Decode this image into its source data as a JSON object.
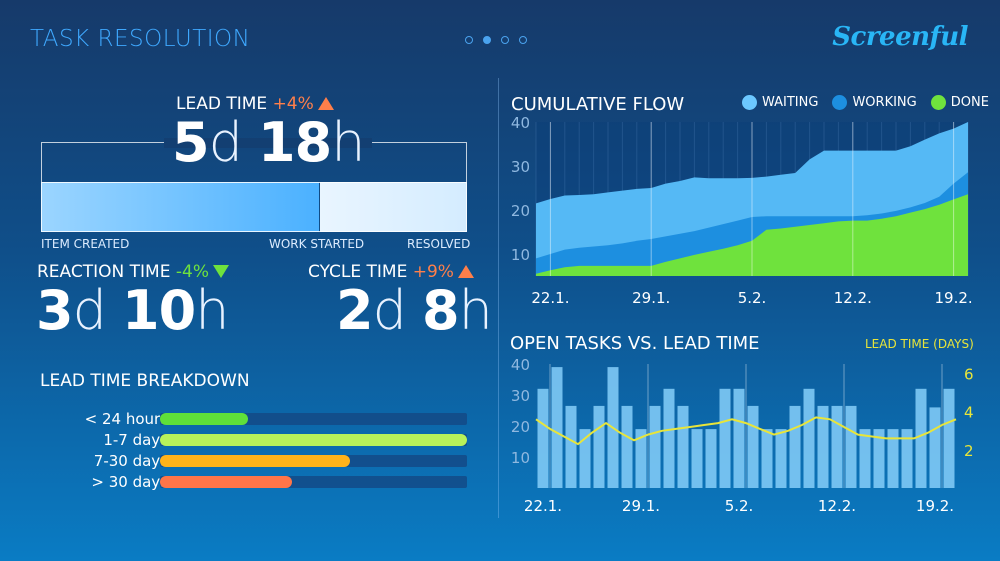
{
  "header": {
    "title": "TASK RESOLUTION",
    "brand": "Screenful",
    "dots": 4,
    "active_dot": 1
  },
  "lead_time": {
    "label": "LEAD TIME",
    "change": "+4%",
    "days": "5",
    "days_unit": "d",
    "hours": "18",
    "hours_unit": "h",
    "markers": {
      "created": "ITEM CREATED",
      "started": "WORK STARTED",
      "resolved": "RESOLVED"
    }
  },
  "reaction_time": {
    "label": "REACTION TIME",
    "change": "-4%",
    "days": "3",
    "days_unit": "d",
    "hours": "10",
    "hours_unit": "h"
  },
  "cycle_time": {
    "label": "CYCLE TIME",
    "change": "+9%",
    "days": "2",
    "days_unit": "d",
    "hours": "8",
    "hours_unit": "h"
  },
  "breakdown": {
    "title": "LEAD TIME BREAKDOWN",
    "max": 21,
    "rows": [
      {
        "label": "< 24 hours",
        "count": 6,
        "color": "#5fe03a"
      },
      {
        "label": "1-7 days",
        "count": 21,
        "color": "#b8f25a"
      },
      {
        "label": "7-30 days",
        "count": 13,
        "color": "#ffb31a"
      },
      {
        "label": "> 30 days",
        "count": 9,
        "color": "#ff7548"
      }
    ]
  },
  "chart_data": [
    {
      "type": "area",
      "title": "CUMULATIVE FLOW",
      "ylim": [
        5,
        40
      ],
      "yticks": [
        10,
        20,
        30,
        40
      ],
      "x_labels": [
        "22.1.",
        "29.1.",
        "5.2.",
        "12.2.",
        "19.2."
      ],
      "x_label_index": [
        1,
        8,
        15,
        22,
        29
      ],
      "legend": "top-right",
      "series": [
        {
          "name": "WAITING",
          "color": "#4dbdff",
          "values": [
            21.5,
            22.5,
            23.3,
            23.4,
            23.6,
            24,
            24.4,
            24.8,
            25,
            26,
            26.6,
            27.4,
            27.2,
            27.2,
            27.2,
            27.3,
            27.6,
            28,
            28.4,
            31.5,
            33.5,
            33.5,
            33.5,
            33.5,
            33.5,
            33.5,
            34.5,
            36,
            37.4,
            38.5,
            40
          ]
        },
        {
          "name": "WORKING",
          "color": "#1d8fe0",
          "values": [
            9,
            10,
            11,
            11.4,
            11.7,
            12,
            12.4,
            13,
            13.4,
            14,
            14.6,
            15.2,
            16,
            16.8,
            17.6,
            18.4,
            18.6,
            18.6,
            18.6,
            18.6,
            18.6,
            18.6,
            18.6,
            18.8,
            19.2,
            19.8,
            20.6,
            21.6,
            23,
            26,
            28.6
          ]
        },
        {
          "name": "DONE",
          "color": "#6fe23d",
          "values": [
            5.5,
            6.3,
            7,
            7.3,
            7.3,
            7.3,
            7.3,
            7.3,
            7.3,
            8.2,
            9,
            9.8,
            10.5,
            11.2,
            12,
            13,
            15.5,
            15.8,
            16.2,
            16.6,
            17,
            17.4,
            17.6,
            17.6,
            18,
            18.6,
            19.4,
            20.2,
            21.2,
            22.4,
            23.6
          ]
        }
      ]
    },
    {
      "type": "bar",
      "title": "OPEN TASKS VS. LEAD TIME",
      "right_axis_label": "LEAD TIME (DAYS)",
      "ylim": [
        0,
        40
      ],
      "yticks": [
        10,
        20,
        30,
        40
      ],
      "y2lim": [
        0,
        6.5
      ],
      "y2ticks": [
        2,
        4,
        6
      ],
      "x_labels": [
        "22.1.",
        "29.1.",
        "5.2.",
        "12.2.",
        "19.2."
      ],
      "x_label_index": [
        1,
        8,
        15,
        22,
        29
      ],
      "bar_color": "#7ec9f5",
      "line_color": "#e8e53a",
      "series": [
        {
          "name": "Open tasks",
          "values": [
            32,
            39,
            26.5,
            19,
            26.5,
            39,
            26.5,
            19,
            26.5,
            32,
            26.5,
            19,
            19,
            32,
            32,
            26.5,
            19,
            19,
            26.5,
            32,
            26.5,
            26.5,
            26.5,
            19,
            19,
            19,
            19,
            32,
            26,
            32
          ]
        },
        {
          "name": "Lead time",
          "axis": "right",
          "values": [
            3.6,
            3.1,
            2.7,
            2.3,
            2.9,
            3.4,
            2.9,
            2.5,
            2.8,
            3,
            3.1,
            3.2,
            3.3,
            3.4,
            3.6,
            3.4,
            3.1,
            2.8,
            3,
            3.3,
            3.7,
            3.6,
            3.2,
            2.8,
            2.7,
            2.6,
            2.6,
            2.6,
            2.9,
            3.3,
            3.6
          ]
        }
      ]
    }
  ]
}
